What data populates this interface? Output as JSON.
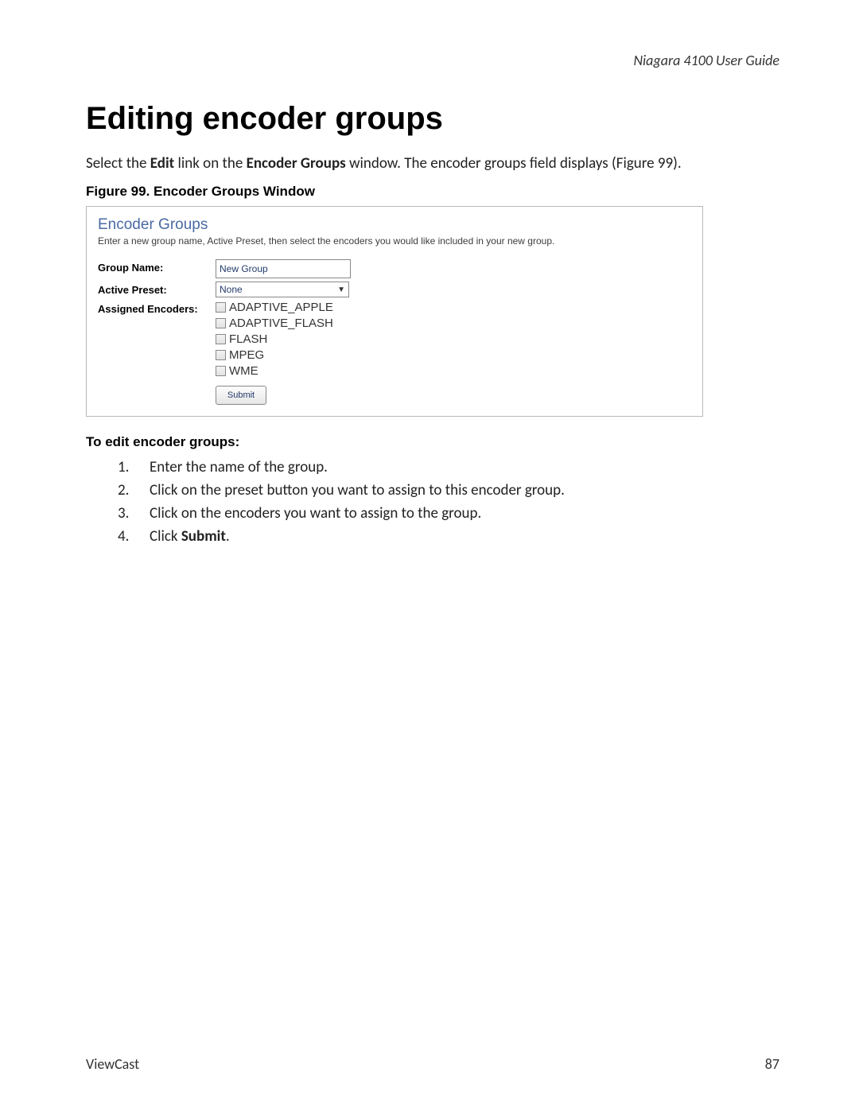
{
  "header": {
    "running_head": "Niagara 4100 User Guide"
  },
  "title": "Editing encoder groups",
  "intro": {
    "prefix": "Select the ",
    "link": "Edit",
    "mid": " link on the ",
    "win": "Encoder Groups",
    "suffix": " window. The encoder groups field displays (Figure 99)."
  },
  "figure_caption": "Figure 99. Encoder Groups Window",
  "screenshot": {
    "title": "Encoder Groups",
    "subtitle": "Enter a new group name, Active Preset, then select the encoders you would like included in your new group.",
    "labels": {
      "group_name": "Group Name:",
      "active_preset": "Active Preset:",
      "assigned": "Assigned Encoders:"
    },
    "group_name_value": "New Group",
    "active_preset_value": "None",
    "encoders": [
      "ADAPTIVE_APPLE",
      "ADAPTIVE_FLASH",
      "FLASH",
      "MPEG",
      "WME"
    ],
    "submit_label": "Submit"
  },
  "steps_heading": "To edit encoder groups:",
  "steps": [
    {
      "n": "1.",
      "text": "Enter the name of the group."
    },
    {
      "n": "2.",
      "text": "Click on the preset button you want to assign to this encoder group."
    },
    {
      "n": "3.",
      "text": "Click on the encoders you want to assign to the group."
    },
    {
      "n": "4.",
      "prefix": "Click ",
      "bold": "Submit",
      "suffix": "."
    }
  ],
  "footer": {
    "left": "ViewCast",
    "right": "87"
  }
}
